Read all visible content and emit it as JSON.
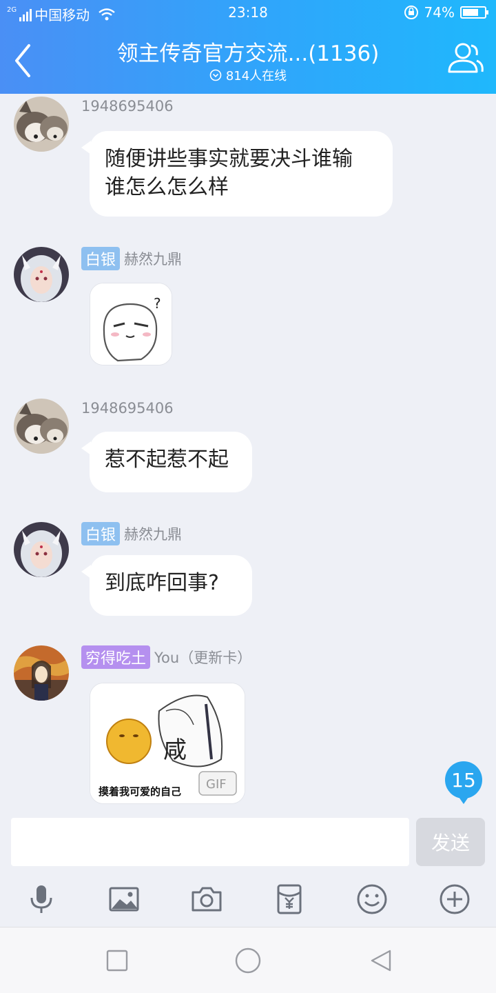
{
  "status_bar": {
    "network_tag": "2G",
    "carrier": "中国移动",
    "time": "23:18",
    "battery": "74%",
    "battery_level": 0.74
  },
  "header": {
    "title": "领主传奇官方交流...(1136)",
    "online": "814人在线"
  },
  "messages": [
    {
      "sender": "1948695406",
      "text_lines": [
        "随便讲些事实就要决斗谁输",
        "谁怎么怎么样"
      ]
    },
    {
      "badge": "白银",
      "sender": "赫然九鼎",
      "sticker": "?"
    },
    {
      "sender": "1948695406",
      "text": "惹不起惹不起"
    },
    {
      "badge": "白银",
      "sender": "赫然九鼎",
      "text": "到底咋回事?"
    },
    {
      "badge": "穷得吃土",
      "sender": "You（更新卡）",
      "sticker_text": "咸",
      "sticker_caption": "摸着我可爱的自己",
      "gif_label": "GIF"
    }
  ],
  "unread_count": "15",
  "composer": {
    "input_value": "",
    "send_label": "发送"
  },
  "toolbar": [
    "microphone-icon",
    "image-icon",
    "camera-icon",
    "red-packet-icon",
    "emoji-icon",
    "plus-icon"
  ],
  "colors": {
    "header_start": "#4a8ff5",
    "header_end": "#1fb8fc",
    "accent": "#2aa6ef",
    "silver_badge": "#8ec0f0",
    "purple_badge": "#b590ef"
  }
}
